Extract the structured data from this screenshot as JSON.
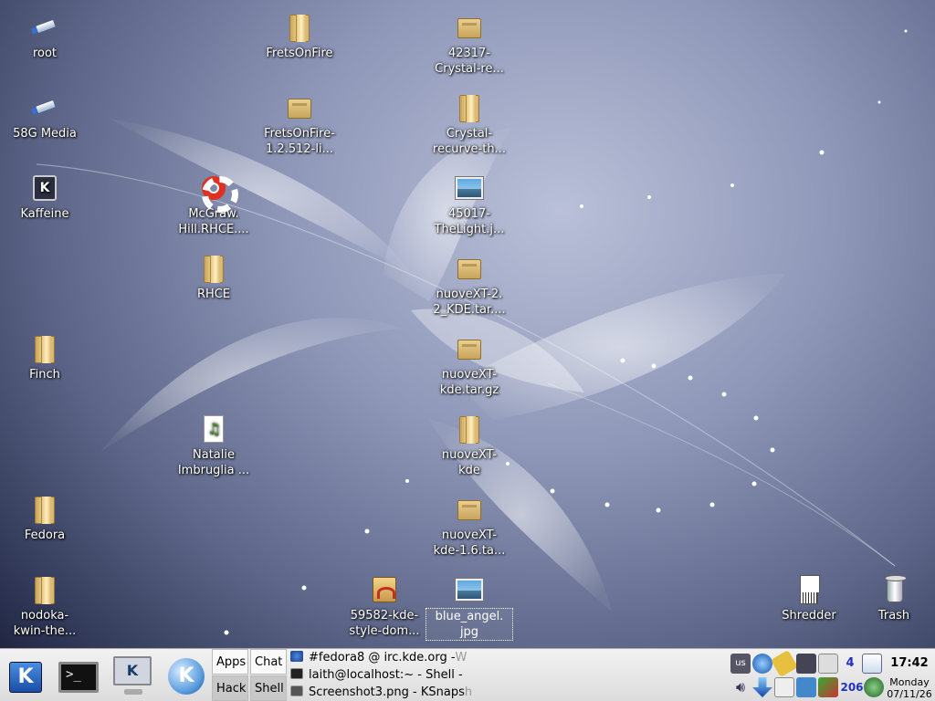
{
  "desktop": {
    "icons": [
      {
        "id": "root",
        "label": "root",
        "icon": "usb-drive-icon"
      },
      {
        "id": "media58",
        "label": "58G Media",
        "icon": "usb-drive-icon"
      },
      {
        "id": "kaffeine",
        "label": "Kaffeine",
        "icon": "kaffeine-icon"
      },
      {
        "id": "finch",
        "label": "Finch",
        "icon": "folder-icon"
      },
      {
        "id": "fedora",
        "label": "Fedora",
        "icon": "folder-icon"
      },
      {
        "id": "nodoka",
        "label": "nodoka-\nkwin-the...",
        "icon": "folder-icon"
      },
      {
        "id": "fretsonfire",
        "label": "FretsOnFire",
        "icon": "folder-icon"
      },
      {
        "id": "fretsonfire_arch",
        "label": "FretsOnFire-\n1.2.512-li...",
        "icon": "archive-icon"
      },
      {
        "id": "mcgraw",
        "label": "McGraw.\nHill.RHCE....",
        "icon": "lifebuoy-icon"
      },
      {
        "id": "rhce",
        "label": "RHCE",
        "icon": "folder-icon"
      },
      {
        "id": "natalie",
        "label": "Natalie\nImbruglia ...",
        "icon": "audio-file-icon"
      },
      {
        "id": "kde_style",
        "label": "59582-kde-\nstyle-dom...",
        "icon": "kde-style-package-icon"
      },
      {
        "id": "crystal_arch",
        "label": "42317-\nCrystal-re...",
        "icon": "archive-icon"
      },
      {
        "id": "crystal",
        "label": "Crystal-\nrecurve-th...",
        "icon": "folder-icon"
      },
      {
        "id": "thelight",
        "label": "45017-\nTheLight.j...",
        "icon": "image-file-icon"
      },
      {
        "id": "nuove22",
        "label": "nuoveXT-2.\n2_KDE.tar....",
        "icon": "archive-icon"
      },
      {
        "id": "nuovekde_tgz",
        "label": "nuoveXT-\nkde.tar.gz",
        "icon": "archive-icon"
      },
      {
        "id": "nuovekde",
        "label": "nuoveXT-\nkde",
        "icon": "folder-icon"
      },
      {
        "id": "nuove16",
        "label": "nuoveXT-\nkde-1.6.ta...",
        "icon": "archive-icon"
      },
      {
        "id": "blueangel",
        "label": "blue_angel.\njpg",
        "icon": "image-file-icon",
        "selected": true
      },
      {
        "id": "shredder",
        "label": "Shredder",
        "icon": "shredder-icon"
      },
      {
        "id": "trash",
        "label": "Trash",
        "icon": "trash-icon"
      }
    ]
  },
  "taskbar": {
    "launchers": [
      {
        "name": "K Menu",
        "icon": "k-menu-icon"
      },
      {
        "name": "Terminal",
        "icon": "terminal-icon"
      },
      {
        "name": "Konsole",
        "icon": "monitor-icon"
      },
      {
        "name": "Konqueror",
        "icon": "konqueror-icon"
      }
    ],
    "pager": {
      "desktops": [
        "Apps",
        "Chat",
        "Hack",
        "Shell"
      ],
      "active": "Hack"
    },
    "tasks": [
      {
        "title": "#fedora8 @ irc.kde.org - ",
        "dim": "W",
        "icon": "irc-icon"
      },
      {
        "title": "laith@localhost:~ - Shell - ",
        "dim": "",
        "icon": "shell-icon"
      },
      {
        "title": "Screenshot3.png - KSnaps",
        "dim": "h",
        "icon": "ksnapshot-icon"
      }
    ],
    "tray": {
      "keyboard_layout": "us",
      "workspace_number": "4",
      "counter": "206"
    },
    "clock": {
      "time": "17:42",
      "weekday": "Monday",
      "date": "07/11/26"
    }
  }
}
